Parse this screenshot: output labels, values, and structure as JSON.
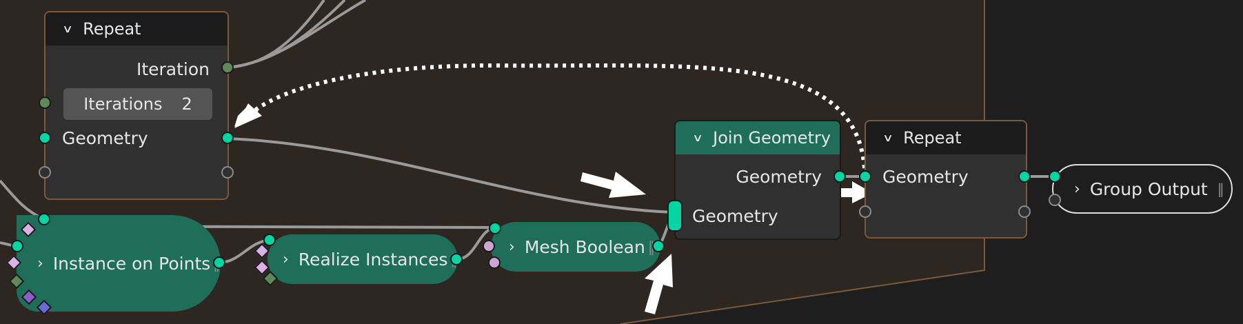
{
  "colors": {
    "socket_geometry": "#00d6a3",
    "socket_integer": "#5e8a5b",
    "node_green_header": "#1e6e5a",
    "frame_border": "#7a5a3c",
    "background": "#1e1e1e",
    "frame_fill": "#2e2620"
  },
  "repeat_input": {
    "title": "Repeat",
    "iteration_label": "Iteration",
    "iterations_label": "Iterations",
    "iterations_value": "2",
    "geometry_label": "Geometry"
  },
  "join_geometry": {
    "title": "Join Geometry",
    "output_label": "Geometry",
    "input_label": "Geometry"
  },
  "repeat_output": {
    "title": "Repeat",
    "geometry_label": "Geometry"
  },
  "instance_on_points": {
    "label": "Instance on Points"
  },
  "realize_instances": {
    "label": "Realize Instances"
  },
  "mesh_boolean": {
    "label": "Mesh Boolean"
  },
  "group_output": {
    "label": "Group Output"
  },
  "icons": {
    "collapse": "chevron-down-icon",
    "expand": "chevron-right-icon",
    "annotation": "arrow-icon",
    "grip": "drag-grip-icon"
  }
}
